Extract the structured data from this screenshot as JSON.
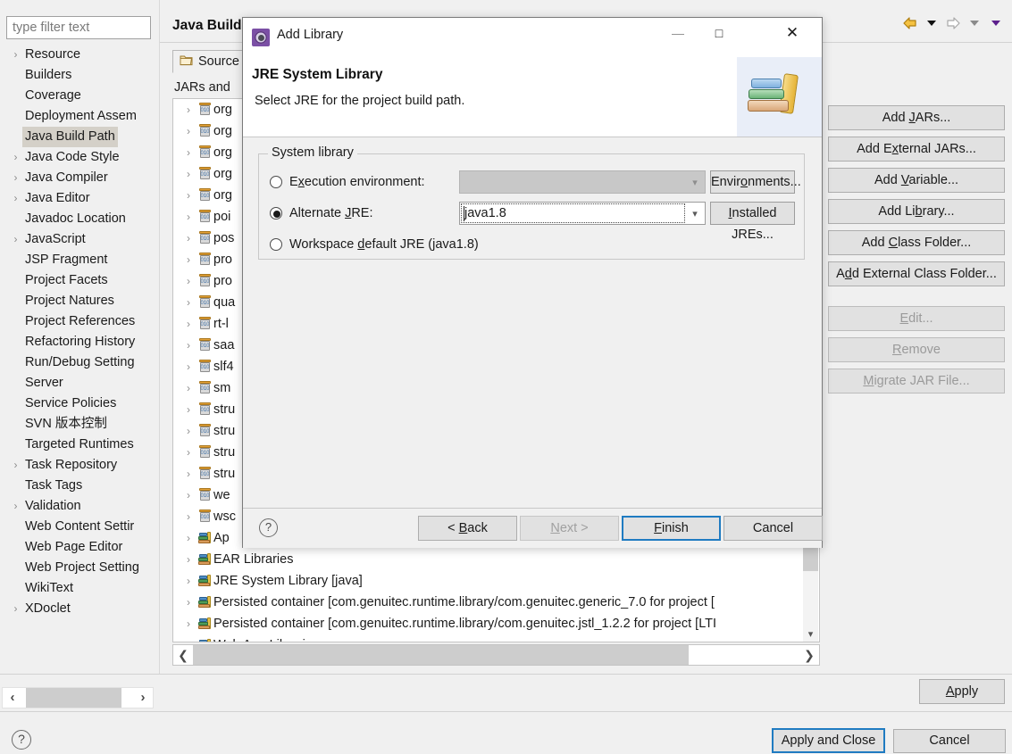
{
  "sidebar": {
    "filter_placeholder": "type filter text",
    "items": [
      {
        "label": "Resource",
        "expandable": true,
        "selected": false
      },
      {
        "label": "Builders",
        "expandable": false,
        "selected": false
      },
      {
        "label": "Coverage",
        "expandable": false,
        "selected": false
      },
      {
        "label": "Deployment Assem",
        "expandable": false,
        "selected": false
      },
      {
        "label": "Java Build Path",
        "expandable": false,
        "selected": true
      },
      {
        "label": "Java Code Style",
        "expandable": true,
        "selected": false
      },
      {
        "label": "Java Compiler",
        "expandable": true,
        "selected": false
      },
      {
        "label": "Java Editor",
        "expandable": true,
        "selected": false
      },
      {
        "label": "Javadoc Location",
        "expandable": false,
        "selected": false
      },
      {
        "label": "JavaScript",
        "expandable": true,
        "selected": false
      },
      {
        "label": "JSP Fragment",
        "expandable": false,
        "selected": false
      },
      {
        "label": "Project Facets",
        "expandable": false,
        "selected": false
      },
      {
        "label": "Project Natures",
        "expandable": false,
        "selected": false
      },
      {
        "label": "Project References",
        "expandable": false,
        "selected": false
      },
      {
        "label": "Refactoring History",
        "expandable": false,
        "selected": false
      },
      {
        "label": "Run/Debug Setting",
        "expandable": false,
        "selected": false
      },
      {
        "label": "Server",
        "expandable": false,
        "selected": false
      },
      {
        "label": "Service Policies",
        "expandable": false,
        "selected": false
      },
      {
        "label": "SVN 版本控制",
        "expandable": false,
        "selected": false
      },
      {
        "label": "Targeted Runtimes",
        "expandable": false,
        "selected": false
      },
      {
        "label": "Task Repository",
        "expandable": true,
        "selected": false
      },
      {
        "label": "Task Tags",
        "expandable": false,
        "selected": false
      },
      {
        "label": "Validation",
        "expandable": true,
        "selected": false
      },
      {
        "label": "Web Content Settir",
        "expandable": false,
        "selected": false
      },
      {
        "label": "Web Page Editor",
        "expandable": false,
        "selected": false
      },
      {
        "label": "Web Project Setting",
        "expandable": false,
        "selected": false
      },
      {
        "label": "WikiText",
        "expandable": false,
        "selected": false
      },
      {
        "label": "XDoclet",
        "expandable": true,
        "selected": false
      }
    ]
  },
  "main": {
    "page_title": "Java Build",
    "tab_source_label": "Source",
    "jars_label": "JARs and",
    "libtree_rows": [
      {
        "text": "org",
        "icon": "jar-icon"
      },
      {
        "text": "org",
        "icon": "jar-icon"
      },
      {
        "text": "org",
        "icon": "jar-icon"
      },
      {
        "text": "org",
        "icon": "jar-icon"
      },
      {
        "text": "org",
        "icon": "jar-icon"
      },
      {
        "text": "poi",
        "icon": "jar-icon"
      },
      {
        "text": "pos",
        "icon": "jar-icon"
      },
      {
        "text": "pro",
        "icon": "jar-icon"
      },
      {
        "text": "pro",
        "icon": "jar-icon"
      },
      {
        "text": "qua",
        "icon": "jar-icon"
      },
      {
        "text": "rt-l",
        "icon": "jar-icon"
      },
      {
        "text": "saa",
        "icon": "jar-icon"
      },
      {
        "text": "slf4",
        "icon": "jar-icon"
      },
      {
        "text": "sm",
        "icon": "jar-icon"
      },
      {
        "text": "stru",
        "icon": "jar-icon"
      },
      {
        "text": "stru",
        "icon": "jar-icon"
      },
      {
        "text": "stru",
        "icon": "jar-icon"
      },
      {
        "text": "stru",
        "icon": "jar-icon"
      },
      {
        "text": "we",
        "icon": "jar-icon"
      },
      {
        "text": "wsc",
        "icon": "jar-icon"
      },
      {
        "text": "Ap",
        "icon": "library-icon"
      },
      {
        "text": "EAR Libraries",
        "icon": "library-icon"
      },
      {
        "text": "JRE System Library [java]",
        "icon": "library-icon"
      },
      {
        "text": "Persisted container [com.genuitec.runtime.library/com.genuitec.generic_7.0 for project [",
        "icon": "library-icon"
      },
      {
        "text": "Persisted container [com.genuitec.runtime.library/com.genuitec.jstl_1.2.2 for project [LTI",
        "icon": "library-icon"
      },
      {
        "text": "Web App Libraries",
        "icon": "library-icon"
      }
    ],
    "buttons": [
      {
        "label": "Add JARs...",
        "mnemonic": "J",
        "disabled": false
      },
      {
        "label": "Add External JARs...",
        "mnemonic": "x",
        "disabled": false
      },
      {
        "label": "Add Variable...",
        "mnemonic": "V",
        "disabled": false
      },
      {
        "label": "Add Library...",
        "mnemonic": "b",
        "disabled": false
      },
      {
        "label": "Add Class Folder...",
        "mnemonic": "C",
        "disabled": false
      },
      {
        "label": "Add External Class Folder...",
        "mnemonic": "d",
        "disabled": false
      },
      {
        "label": "Edit...",
        "mnemonic": "E",
        "disabled": true
      },
      {
        "label": "Remove",
        "mnemonic": "R",
        "disabled": true
      },
      {
        "label": "Migrate JAR File...",
        "mnemonic": "M",
        "disabled": true
      }
    ],
    "apply_label": "Apply",
    "apply_and_close_label": "Apply and Close",
    "cancel_label": "Cancel",
    "help_glyph": "?"
  },
  "dialog": {
    "window_title": "Add Library",
    "heading": "JRE System Library",
    "subtitle": "Select JRE for the project build path.",
    "minimize_glyph": "—",
    "maximize_glyph": "□",
    "close_glyph": "✕",
    "group_legend": "System library",
    "radios": [
      {
        "label": "Execution environment:",
        "mnemonic": "x",
        "checked": false
      },
      {
        "label": "Alternate JRE:",
        "mnemonic": "J",
        "checked": true
      },
      {
        "label": "Workspace default JRE (java1.8)",
        "mnemonic": "d",
        "checked": false
      }
    ],
    "combo_execution_value": "",
    "combo_alternate_value": "java1.8",
    "btn_environments": "Environments...",
    "btn_environments_mnemonic": "o",
    "btn_installed_jres": "Installed JREs...",
    "btn_installed_jres_mnemonic": "I",
    "help_glyph": "?",
    "btn_back": "< Back",
    "btn_back_mnemonic": "B",
    "btn_next": "Next >",
    "btn_next_mnemonic": "N",
    "btn_finish": "Finish",
    "btn_finish_mnemonic": "F",
    "btn_cancel": "Cancel"
  },
  "colors": {
    "accent_focus": "#1f7bc1",
    "selection_gray": "#d4d0c8",
    "dialog_bg": "#f0f0f0",
    "app_icon_purple": "#7b4fa5"
  }
}
